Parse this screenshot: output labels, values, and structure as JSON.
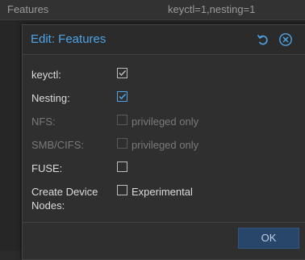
{
  "background": {
    "row_key": "Features",
    "row_value": "keyctl=1,nesting=1"
  },
  "dialog": {
    "title": "Edit: Features",
    "tools": [
      {
        "name": "reset",
        "icon": "undo-icon"
      },
      {
        "name": "close",
        "icon": "close-circle-icon"
      }
    ],
    "fields": [
      {
        "label": "keyctl:",
        "checked": true,
        "disabled": false,
        "box_label": ""
      },
      {
        "label": "Nesting:",
        "checked": true,
        "disabled": false,
        "box_label": ""
      },
      {
        "label": "NFS:",
        "checked": false,
        "disabled": true,
        "box_label": "privileged only"
      },
      {
        "label": "SMB/CIFS:",
        "checked": false,
        "disabled": true,
        "box_label": "privileged only"
      },
      {
        "label": "FUSE:",
        "checked": false,
        "disabled": false,
        "box_label": ""
      },
      {
        "label": "Create Device Nodes:",
        "checked": false,
        "disabled": false,
        "box_label": "Experimental"
      }
    ],
    "ok_label": "OK"
  },
  "colors": {
    "accent": "#4ea3e6",
    "background": "#2b2b2b",
    "ok_button": "#28456a"
  }
}
